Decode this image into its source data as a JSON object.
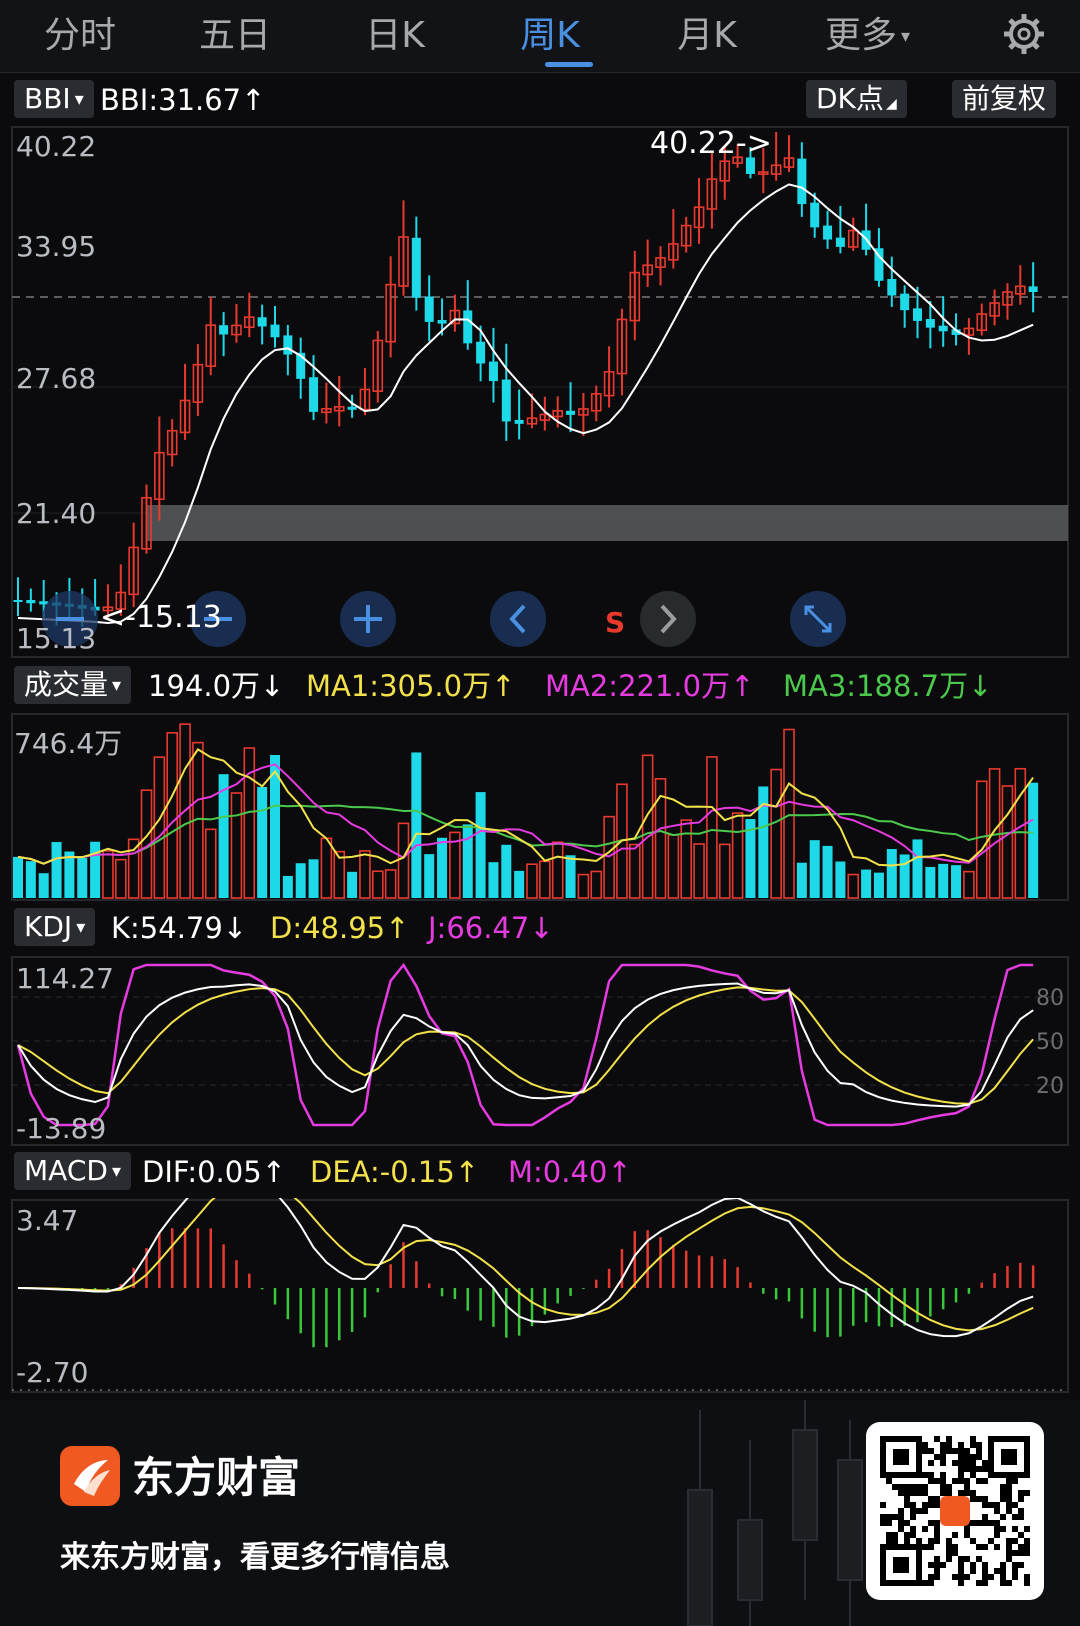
{
  "tabs": {
    "items": [
      "分时",
      "五日",
      "日K",
      "周K",
      "月K",
      "更多"
    ],
    "active": "周K"
  },
  "toolbar": {
    "indicator": "BBI",
    "bbi": "BBI:31.67↑",
    "dk": "DK点",
    "fuquan": "前复权"
  },
  "price": {
    "ticks": [
      "40.22",
      "33.95",
      "27.68",
      "21.40",
      "15.13"
    ],
    "high_label": "40.22->",
    "low_label": "<-15.13",
    "signal": "S"
  },
  "volume": {
    "name": "成交量",
    "value": "194.0万↓",
    "ma1": "MA1:305.0万↑",
    "ma2": "MA2:221.0万↑",
    "ma3": "MA3:188.7万↓",
    "max": "746.4万"
  },
  "kdj": {
    "name": "KDJ",
    "k": "K:54.79↓",
    "d": "D:48.95↑",
    "j": "J:66.47↓",
    "max": "114.27",
    "min": "-13.89",
    "levels": [
      "80",
      "50",
      "20"
    ]
  },
  "macd": {
    "name": "MACD",
    "dif": "DIF:0.05↑",
    "dea": "DEA:-0.15↑",
    "m": "M:0.40↑",
    "max": "3.47",
    "min": "-2.70"
  },
  "footer": {
    "brand": "东方财富",
    "slogan": "来东方财富，看更多行情信息"
  },
  "colors": {
    "up": "#e8392f",
    "down": "#1ed9e8",
    "ma1": "#f2e14a",
    "ma2": "#e63be0",
    "ma3": "#4cc94c",
    "accent": "#4a90e2",
    "bbi_line": "#ffffff"
  }
}
